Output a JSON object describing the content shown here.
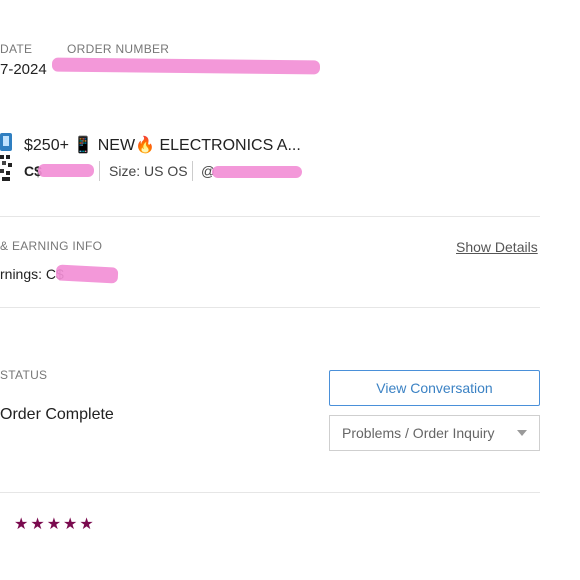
{
  "order_header": {
    "date_label": "DATE",
    "date_value": "7-2024",
    "order_number_label": "ORDER NUMBER",
    "order_number_value": ""
  },
  "listing": {
    "title": "$250+ 📱 NEW🔥 ELECTRONICS A...",
    "price_prefix": "C$",
    "size_text": "Size: US OS",
    "seller_prefix": "@"
  },
  "earnings": {
    "section_label": "& EARNING INFO",
    "earnings_label": "rnings: C$",
    "show_details_link": "Show Details"
  },
  "status": {
    "section_label": "STATUS",
    "status_value": "Order Complete",
    "view_conversation_button": "View Conversation",
    "problems_button": "Problems / Order Inquiry"
  },
  "rating": {
    "stars_filled": 5,
    "stars_text": "★★★★★"
  },
  "colors": {
    "accent_blue": "#3b82c4",
    "star_color": "#7a0a4e",
    "redaction_pink": "#f28fd6"
  }
}
